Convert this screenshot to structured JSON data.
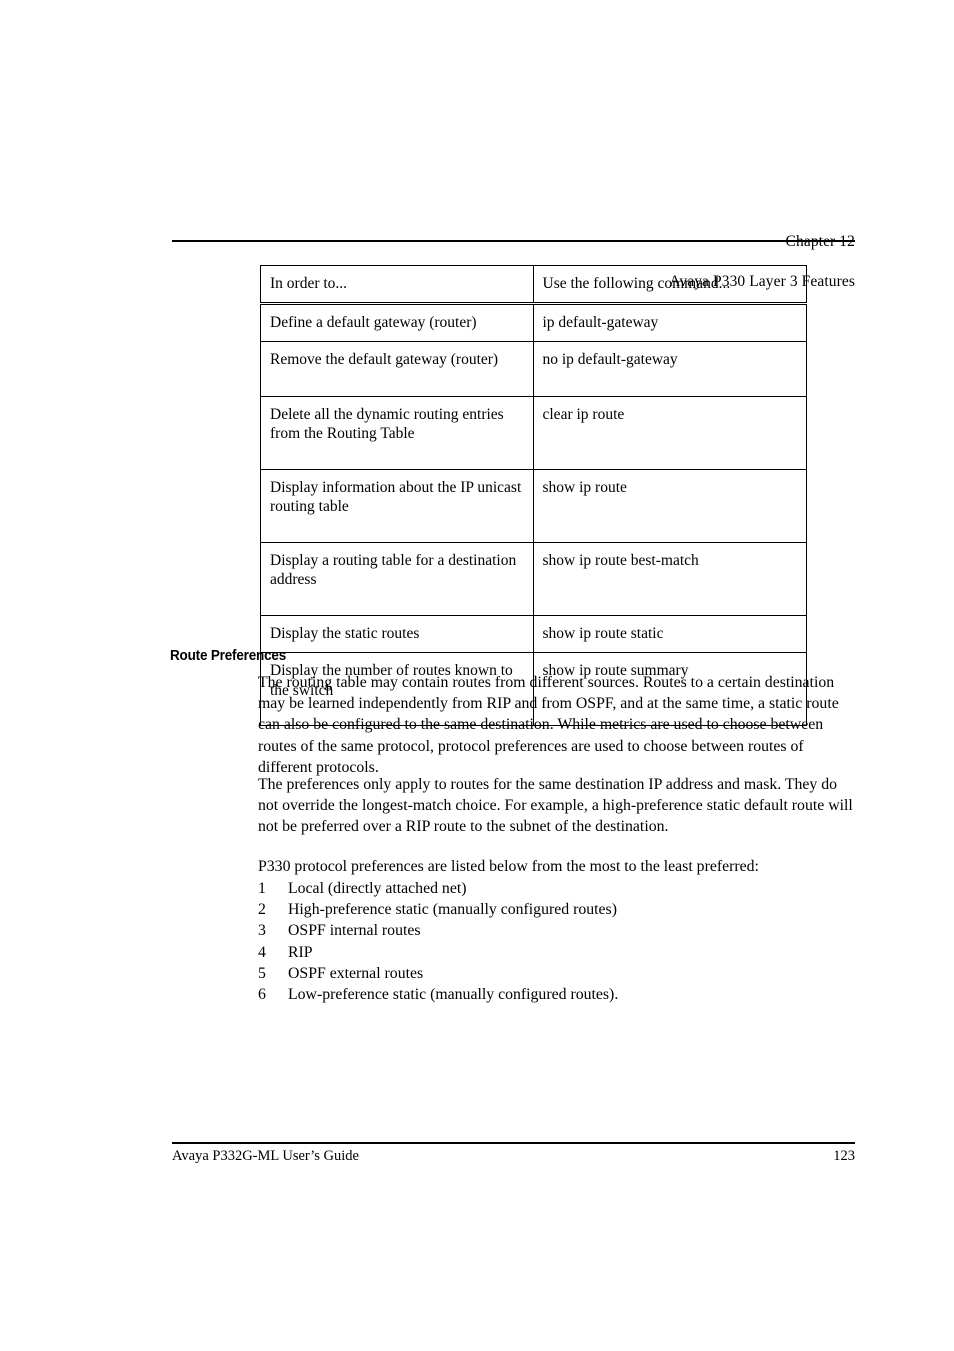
{
  "header": {
    "chapter": "Chapter 12",
    "title": "Avaya P330 Layer 3 Features"
  },
  "command_table": {
    "columns": [
      "In order to...",
      "Use the following command..."
    ],
    "rows": [
      {
        "task": "Define a default gateway (router)",
        "command": "ip default-gateway"
      },
      {
        "task": "Remove the default gateway (router)",
        "command": "no ip default-gateway"
      },
      {
        "task": "Delete all the dynamic routing entries from the Routing Table",
        "command": "clear ip route"
      },
      {
        "task": "Display information about the IP unicast routing table",
        "command": "show ip route"
      },
      {
        "task": "Display a routing table for a destination address",
        "command": "show ip route best-match"
      },
      {
        "task": "Display the static routes",
        "command": "show ip route static"
      },
      {
        "task": "Display the number of routes known to the switch",
        "command": "show ip route summary"
      }
    ]
  },
  "section": {
    "heading": "Route Preferences",
    "paragraphs": [
      "The routing table may contain routes from different sources. Routes to a certain destination may be learned independently from RIP and from OSPF, and at the same time, a static route can also be configured to the same destination. While metrics are used to choose between routes of the same protocol, protocol preferences are used to choose between routes of different protocols.",
      "The preferences only apply to routes for the same destination IP address and mask. They do not override the longest-match choice. For example, a high-preference static default route will not be preferred over a RIP route to the subnet of the destination.",
      "P330 protocol preferences are listed below from the most to the least preferred:"
    ],
    "preference_list": [
      {
        "number": "1",
        "text": "Local (directly attached net)"
      },
      {
        "number": "2",
        "text": "High-preference static (manually configured routes)"
      },
      {
        "number": "3",
        "text": "OSPF internal routes"
      },
      {
        "number": "4",
        "text": "RIP"
      },
      {
        "number": "5",
        "text": "OSPF external routes"
      },
      {
        "number": "6",
        "text": "Low-preference static (manually configured routes)."
      }
    ]
  },
  "footer": {
    "guide_title": "Avaya P332G-ML User’s Guide",
    "page_number": "123"
  }
}
